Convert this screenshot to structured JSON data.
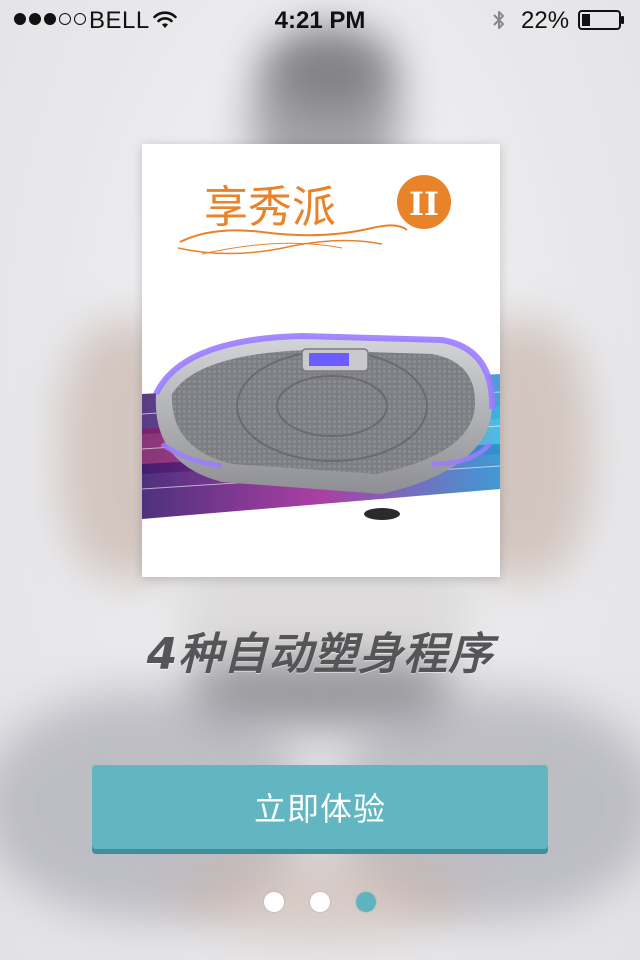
{
  "status_bar": {
    "carrier": "BELL",
    "signal_bars": 3,
    "signal_total": 5,
    "time": "4:21 PM",
    "battery_percent": "22%",
    "battery_level": 0.22,
    "icons": [
      "wifi-icon",
      "bluetooth-icon",
      "battery-icon"
    ]
  },
  "product": {
    "brand_name": "享秀派",
    "brand_badge": "II",
    "brand_color": "#e8832a"
  },
  "headline": "4种自动塑身程序",
  "cta": {
    "label": "立即体验",
    "color": "#62b6c2"
  },
  "pager": {
    "total": 3,
    "active_index": 2,
    "active_color": "#5fb3bf"
  }
}
